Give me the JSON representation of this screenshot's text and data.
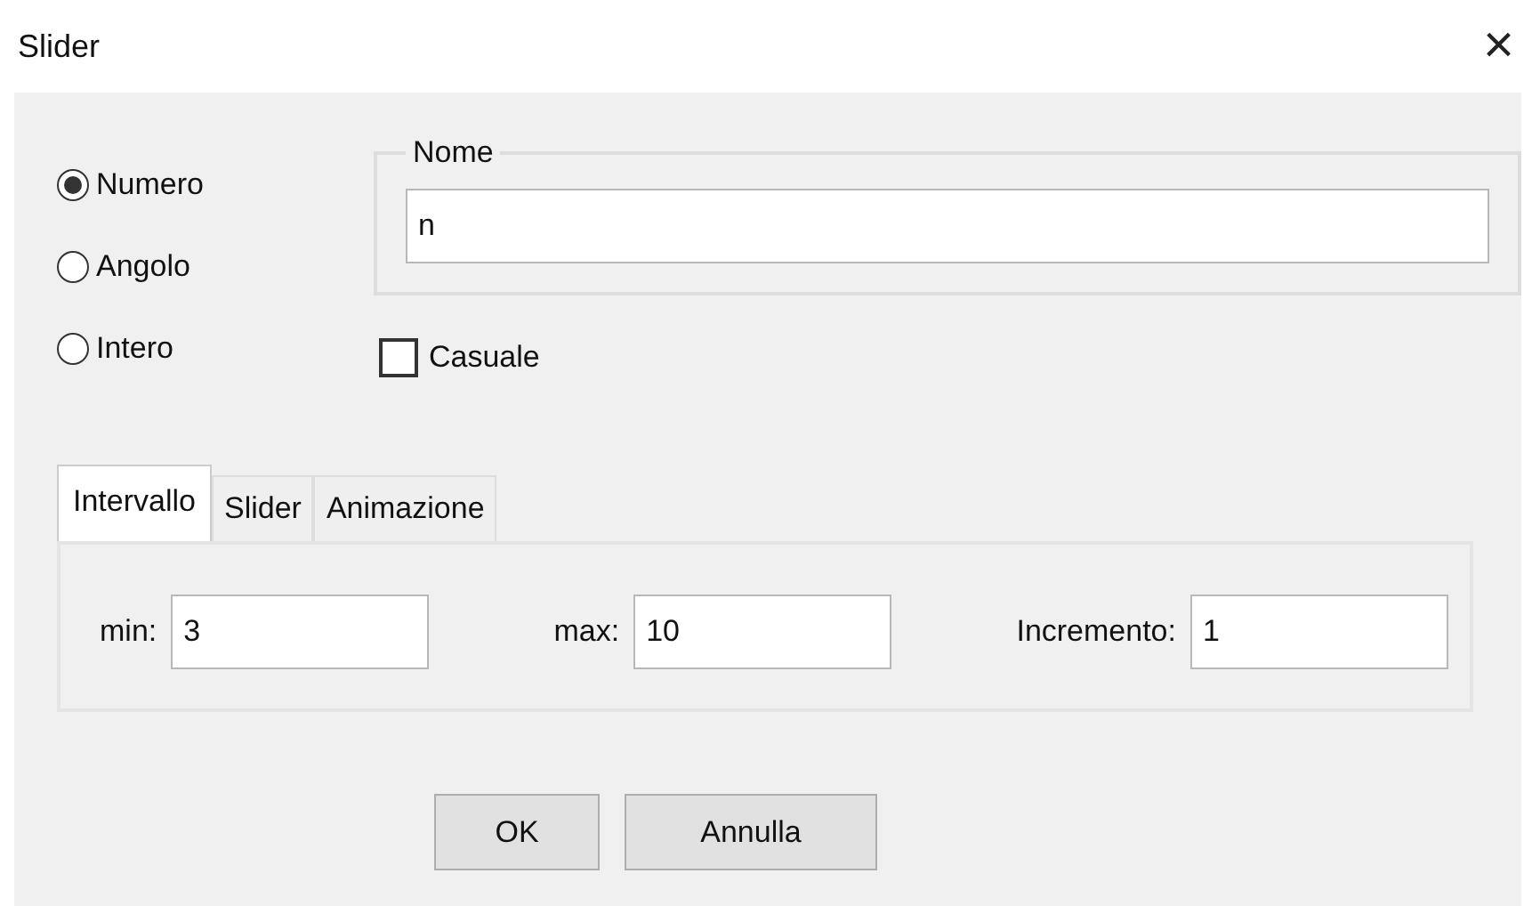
{
  "window": {
    "title": "Slider",
    "close": "×"
  },
  "types": [
    {
      "label": "Numero",
      "selected": true
    },
    {
      "label": "Angolo",
      "selected": false
    },
    {
      "label": "Intero",
      "selected": false
    }
  ],
  "name_group": {
    "legend": "Nome",
    "value": "n"
  },
  "random": {
    "label": "Casuale",
    "checked": false
  },
  "tabs": [
    {
      "label": "Intervallo",
      "selected": true
    },
    {
      "label": "Slider",
      "selected": false
    },
    {
      "label": "Animazione",
      "selected": false
    }
  ],
  "fields": [
    {
      "label": "min:",
      "value": "3"
    },
    {
      "label": "max:",
      "value": "10"
    },
    {
      "label": "Incremento:",
      "value": "1"
    }
  ],
  "buttons": [
    "OK",
    "Annulla"
  ]
}
